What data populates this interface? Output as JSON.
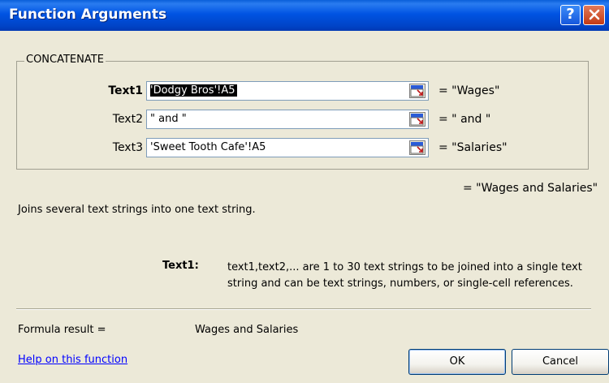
{
  "window": {
    "title": "Function Arguments"
  },
  "function": {
    "name": "CONCATENATE"
  },
  "arguments": [
    {
      "label": "Text1",
      "value": "'Dodgy Bros'!A5",
      "result": "= \"Wages\""
    },
    {
      "label": "Text2",
      "value": "\" and \"",
      "result": "= \" and \""
    },
    {
      "label": "Text3",
      "value": "'Sweet Tooth Cafe'!A5",
      "result": "= \"Salaries\""
    }
  ],
  "final_result": "= \"Wages and Salaries\"",
  "description": "Joins several text strings into one text string.",
  "arg_help": {
    "name": "Text1:",
    "text": "text1,text2,... are 1 to 30 text strings to be joined into a single text string and can be text strings, numbers, or single-cell references."
  },
  "formula": {
    "label": "Formula result =",
    "value": "Wages and Salaries"
  },
  "help_link": "Help on this function",
  "buttons": {
    "ok": "OK",
    "cancel": "Cancel"
  },
  "icons": {
    "help": "question-icon",
    "close": "close-icon",
    "collapse": "range-select-icon"
  },
  "colors": {
    "title_bar": "#0054e3",
    "background": "#ece9d8",
    "link": "#0000ff"
  }
}
